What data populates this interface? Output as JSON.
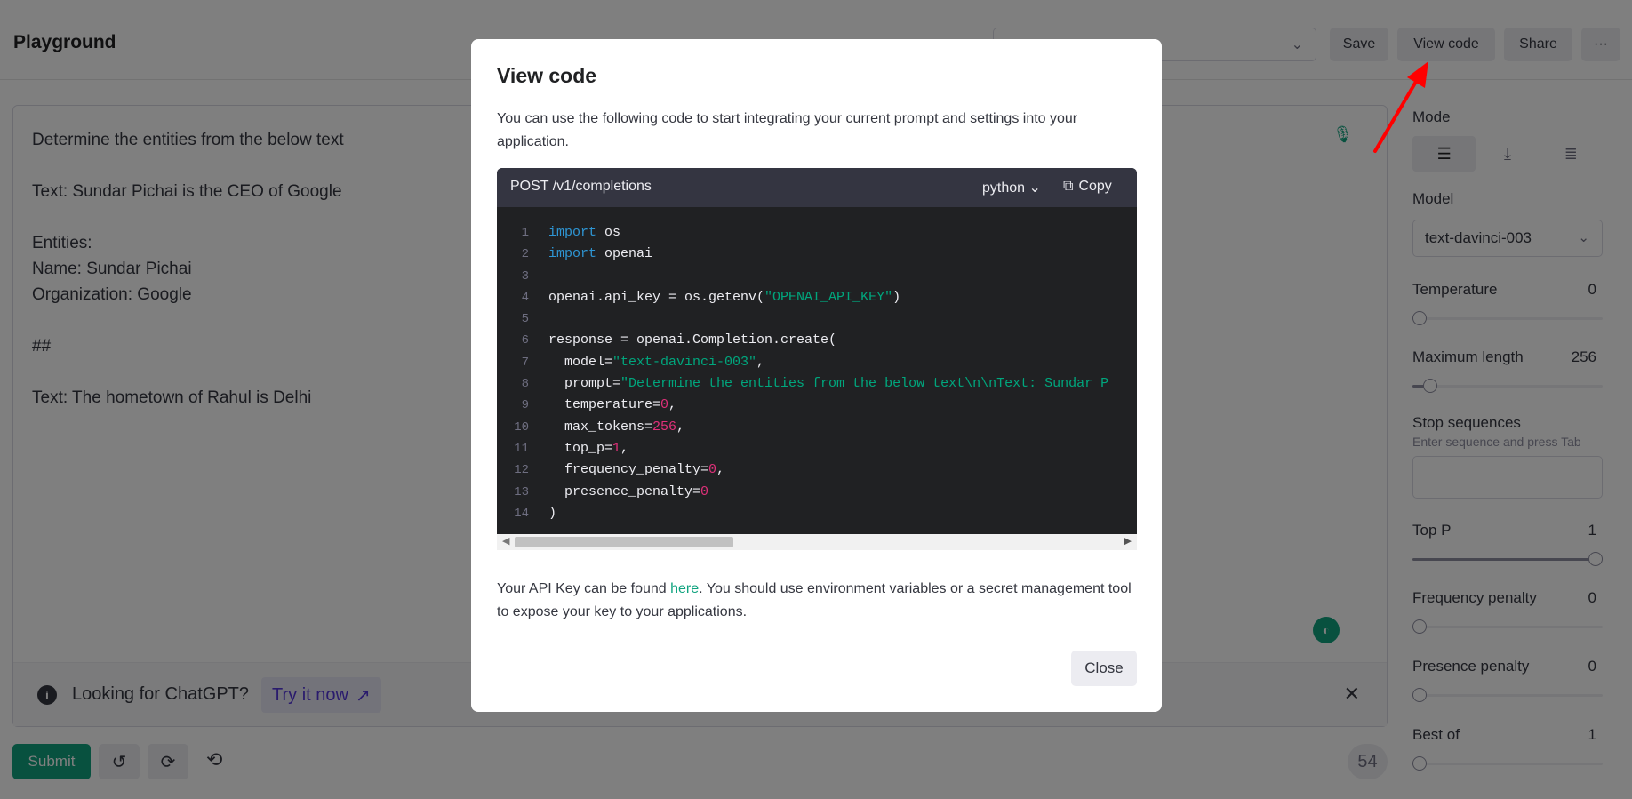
{
  "header": {
    "title": "Playground",
    "buttons": {
      "save": "Save",
      "view_code": "View code",
      "share": "Share",
      "more": "···"
    }
  },
  "editor": {
    "text": "Determine the entities from the below text\n\nText: Sundar Pichai is the CEO of Google\n\nEntities:\nName: Sundar Pichai\nOrganization: Google\n\n##\n\nText: The hometown of Rahul is Delhi"
  },
  "banner": {
    "message": "Looking for ChatGPT?",
    "link": "Try it now"
  },
  "footer": {
    "submit": "Submit",
    "token_count": "54"
  },
  "settings": {
    "mode_label": "Mode",
    "model_label": "Model",
    "model_value": "text-davinci-003",
    "temperature": {
      "label": "Temperature",
      "value": "0",
      "level": 0
    },
    "max_length": {
      "label": "Maximum length",
      "value": "256",
      "level": 0.06
    },
    "stop_sequences": {
      "label": "Stop sequences",
      "hint": "Enter sequence and press Tab"
    },
    "top_p": {
      "label": "Top P",
      "value": "1",
      "level": 1
    },
    "frequency_penalty": {
      "label": "Frequency penalty",
      "value": "0",
      "level": 0
    },
    "presence_penalty": {
      "label": "Presence penalty",
      "value": "0",
      "level": 0
    },
    "best_of": {
      "label": "Best of",
      "value": "1",
      "level": 0
    }
  },
  "modal": {
    "title": "View code",
    "description": "You can use the following code to start integrating your current prompt and settings into your application.",
    "endpoint": "POST /v1/completions",
    "language": "python",
    "copy": "Copy",
    "note_before": "Your API Key can be found ",
    "note_link": "here",
    "note_after": ". You should use environment variables or a secret management tool to expose your key to your applications.",
    "close": "Close"
  },
  "code_lines": [
    {
      "n": "1",
      "parts": [
        [
          "kw",
          "import"
        ],
        [
          "",
          " os"
        ]
      ]
    },
    {
      "n": "2",
      "parts": [
        [
          "kw",
          "import"
        ],
        [
          "",
          " openai"
        ]
      ]
    },
    {
      "n": "3",
      "parts": []
    },
    {
      "n": "4",
      "parts": [
        [
          "",
          "openai.api_key = os.getenv("
        ],
        [
          "str",
          "\"OPENAI_API_KEY\""
        ],
        [
          "",
          ")"
        ]
      ]
    },
    {
      "n": "5",
      "parts": []
    },
    {
      "n": "6",
      "parts": [
        [
          "",
          "response = openai.Completion.create("
        ]
      ]
    },
    {
      "n": "7",
      "parts": [
        [
          "",
          "  model="
        ],
        [
          "str",
          "\"text-davinci-003\""
        ],
        [
          "",
          ","
        ]
      ]
    },
    {
      "n": "8",
      "parts": [
        [
          "",
          "  prompt="
        ],
        [
          "str",
          "\"Determine the entities from the below text\\n\\nText: Sundar P"
        ]
      ]
    },
    {
      "n": "9",
      "parts": [
        [
          "",
          "  temperature="
        ],
        [
          "num",
          "0"
        ],
        [
          "",
          ","
        ]
      ]
    },
    {
      "n": "10",
      "parts": [
        [
          "",
          "  max_tokens="
        ],
        [
          "num",
          "256"
        ],
        [
          "",
          ","
        ]
      ]
    },
    {
      "n": "11",
      "parts": [
        [
          "",
          "  top_p="
        ],
        [
          "num",
          "1"
        ],
        [
          "",
          ","
        ]
      ]
    },
    {
      "n": "12",
      "parts": [
        [
          "",
          "  frequency_penalty="
        ],
        [
          "num",
          "0"
        ],
        [
          "",
          ","
        ]
      ]
    },
    {
      "n": "13",
      "parts": [
        [
          "",
          "  presence_penalty="
        ],
        [
          "num",
          "0"
        ]
      ]
    },
    {
      "n": "14",
      "parts": [
        [
          "",
          ")"
        ]
      ]
    }
  ],
  "colors": {
    "accent": "#10a37f",
    "arrow": "#ff0000",
    "link": "#5436da"
  }
}
